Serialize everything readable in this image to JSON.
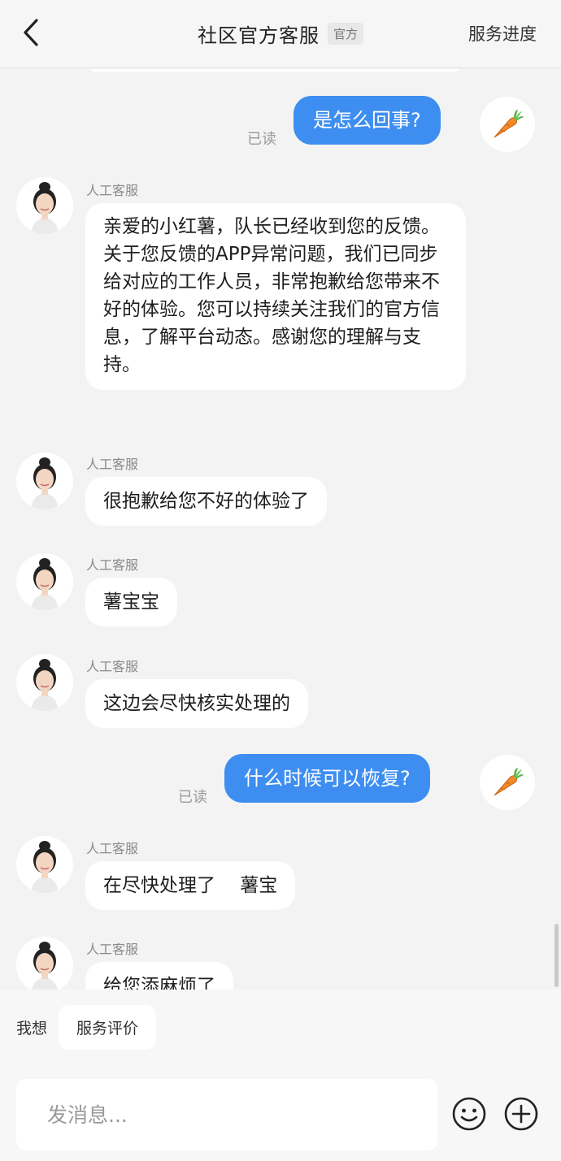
{
  "header": {
    "title": "社区官方客服",
    "badge": "官方",
    "progress_link": "服务进度"
  },
  "messages": [
    {
      "type": "out",
      "text": "是怎么回事?",
      "status": "已读"
    },
    {
      "type": "in",
      "sender": "人工客服",
      "text": "亲爱的小红薯，队长已经收到您的反馈。关于您反馈的APP异常问题，我们已同步给对应的工作人员，非常抱歉给您带来不好的体验。您可以持续关注我们的官方信息，了解平台动态。感谢您的理解与支持。"
    },
    {
      "type": "in",
      "sender": "人工客服",
      "text": "很抱歉给您不好的体验了"
    },
    {
      "type": "in",
      "sender": "人工客服",
      "text": "薯宝宝"
    },
    {
      "type": "in",
      "sender": "人工客服",
      "text": "这边会尽快核实处理的"
    },
    {
      "type": "out",
      "text": "什么时候可以恢复?",
      "status": "已读"
    },
    {
      "type": "in",
      "sender": "人工客服",
      "text": "在尽快处理了　 薯宝"
    },
    {
      "type": "in",
      "sender": "人工客服",
      "text": "给您添麻烦了"
    }
  ],
  "quick_bar": {
    "label": "我想",
    "chip": "服务评价"
  },
  "input": {
    "placeholder": "发消息..."
  },
  "icons": {
    "back": "chevron-left-icon",
    "emoji": "smile-icon",
    "add": "plus-circle-icon",
    "user_avatar": "carrot-icon"
  },
  "colors": {
    "outgoing_bubble": "#3d8ef0",
    "incoming_bubble": "#ffffff",
    "background": "#f3f3f3"
  }
}
